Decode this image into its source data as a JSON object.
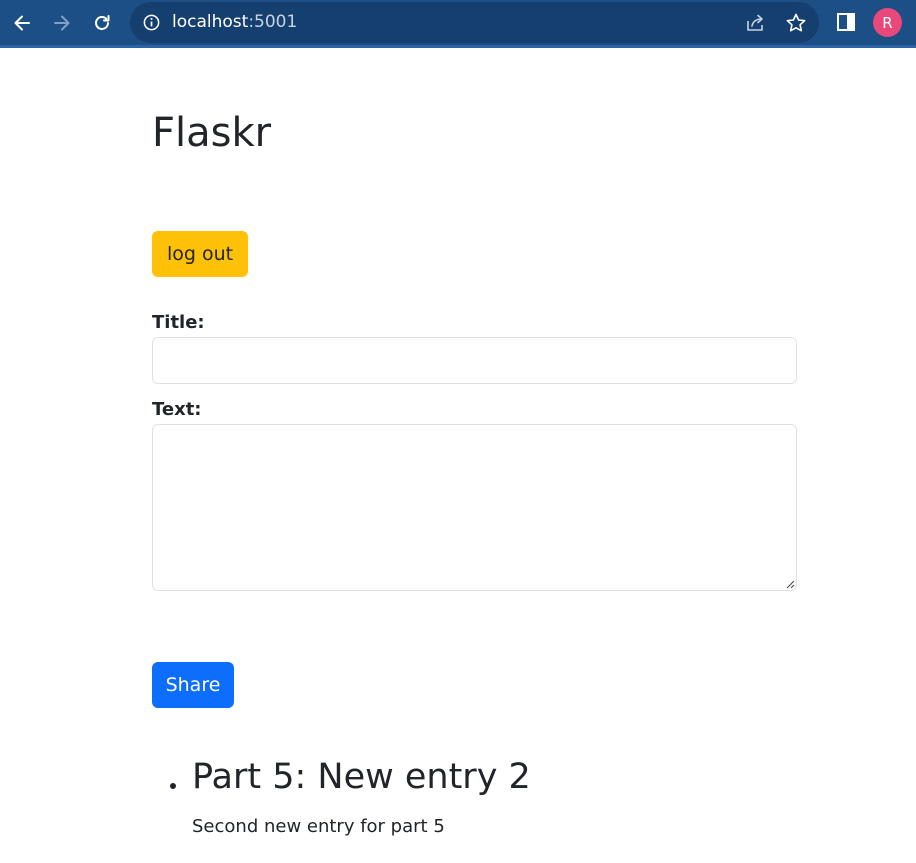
{
  "browser": {
    "url_host": "localhost",
    "url_port": ":5001",
    "avatar_initial": "R",
    "icons": [
      "back-arrow-icon",
      "forward-arrow-icon",
      "reload-icon",
      "info-icon",
      "share-icon",
      "star-icon",
      "side-panel-icon"
    ]
  },
  "page": {
    "title": "Flaskr",
    "logout_label": "log out",
    "form": {
      "title_label": "Title:",
      "title_value": "",
      "text_label": "Text:",
      "text_value": "",
      "share_label": "Share"
    },
    "entries": [
      {
        "title": "Part 5: New entry 2",
        "text": "Second new entry for part 5"
      }
    ]
  },
  "colors": {
    "browser_bar": "#1c4f86",
    "omnibox": "#153f6f",
    "logout_button": "#ffc107",
    "share_button": "#0d6efd",
    "avatar": "#e8487a"
  }
}
